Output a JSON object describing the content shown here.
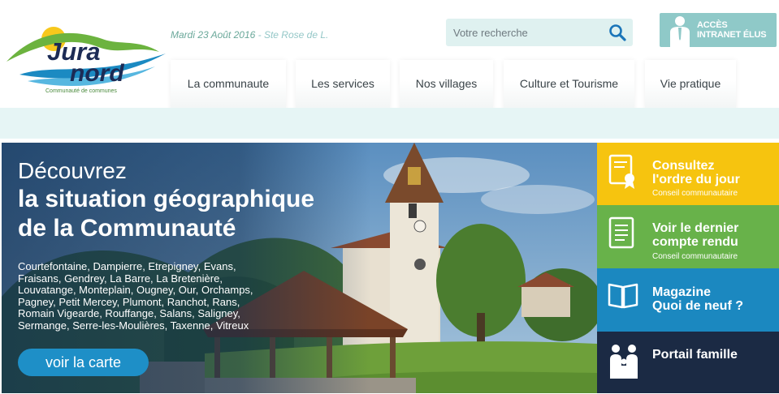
{
  "header": {
    "logo": {
      "word1": "Jura",
      "word2": "nord",
      "tagline": "Communauté de communes"
    },
    "date": "Mardi 23 Août 2016",
    "saint": " - Ste Rose de L.",
    "search": {
      "placeholder": "Votre recherche",
      "icon": "search-icon"
    },
    "intranet": {
      "line1": "ACCÈS",
      "line2": "INTRANET ÉLUS",
      "icon": "person-icon"
    }
  },
  "nav": {
    "items": [
      {
        "label": "La communaute",
        "color": "#1c2b45"
      },
      {
        "label": "Les services",
        "color": "#1b8ac2"
      },
      {
        "label": "Nos villages",
        "color": "#6ab04c"
      },
      {
        "label": "Culture et Tourisme",
        "color": "#f4c21b"
      },
      {
        "label": "Vie pratique",
        "color": "#5aa8a0"
      }
    ]
  },
  "hero": {
    "kicker": "Découvrez",
    "title_line1": "la situation géographique",
    "title_line2": "de la Communauté",
    "villages": "Courtefontaine, Dampierre, Etrepigney, Evans, Fraisans, Gendrey, La Barre, La Bretenière, Louvatange, Monteplain, Ougney, Our, Orchamps, Pagney, Petit Mercey, Plumont, Ranchot, Rans, Romain Vigearde, Rouffange, Salans, Saligney, Sermange, Serre-les-Moulières, Taxenne, Vitreux",
    "cta": "voir la carte"
  },
  "tiles": [
    {
      "line1": "Consultez",
      "line2": "l'ordre du jour",
      "sub": "Conseil communautaire",
      "color": "#f6c40f",
      "icon": "certificate-icon"
    },
    {
      "line1": "Voir le dernier",
      "line2": "compte rendu",
      "sub": "Conseil communautaire",
      "color": "#68b24a",
      "icon": "document-icon"
    },
    {
      "line1": "Magazine",
      "line2": "Quoi de neuf ?",
      "sub": "",
      "color": "#1b88c0",
      "icon": "book-icon"
    },
    {
      "line1": "Portail famille",
      "line2": "",
      "sub": "",
      "color": "#1b2a44",
      "icon": "family-icon"
    }
  ],
  "colors": {
    "accent_teal": "#8fc9c8",
    "search_bg": "#dff1f0",
    "cta_blue": "#1e8fc7"
  }
}
